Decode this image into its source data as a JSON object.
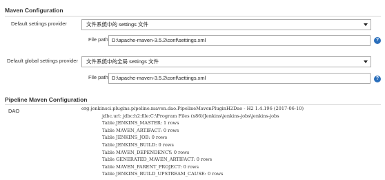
{
  "maven_configuration": {
    "title": "Maven Configuration",
    "default_settings_provider": {
      "label": "Default settings provider",
      "selected": "文件系统中的 settings 文件",
      "file_path_label": "File path",
      "file_path_value": "D:\\apache-maven-3.5.2\\conf\\settings.xml"
    },
    "default_global_settings_provider": {
      "label": "Default global settings provider",
      "selected": "文件系统中的全局 settings 文件",
      "file_path_label": "File path",
      "file_path_value": "D:\\apache-maven-3.5.2\\conf\\settings.xml"
    },
    "help_glyph": "?"
  },
  "pipeline_maven_configuration": {
    "title": "Pipeline Maven Configuration",
    "dao_label": "DAO",
    "dao_lines": [
      "org.jenkinsci.plugins.pipeline.maven.dao.PipelineMavenPluginH2Dao - H2 1.4.196 (2017-06-10)",
      "jdbc.url: jdbc:h2:file:C:\\Program Files (x86)\\Jenkins\\jenkins-jobs\\jenkins-jobs",
      "Table JENKINS_MASTER: 1 rows",
      "Table MAVEN_ARTIFACT: 0 rows",
      "Table JENKINS_JOB: 0 rows",
      "Table JENKINS_BUILD: 0 rows",
      "Table MAVEN_DEPENDENCY: 0 rows",
      "Table GENERATED_MAVEN_ARTIFACT: 0 rows",
      "Table MAVEN_PARENT_PROJECT: 0 rows",
      "Table JENKINS_BUILD_UPSTREAM_CAUSE: 0 rows"
    ]
  },
  "icons": {
    "help": "help-icon",
    "dropdown": "chevron-down-icon"
  },
  "colors": {
    "help_icon": "#2a6ebb",
    "border": "#aaaaaa",
    "rule": "#d4d4d4"
  }
}
